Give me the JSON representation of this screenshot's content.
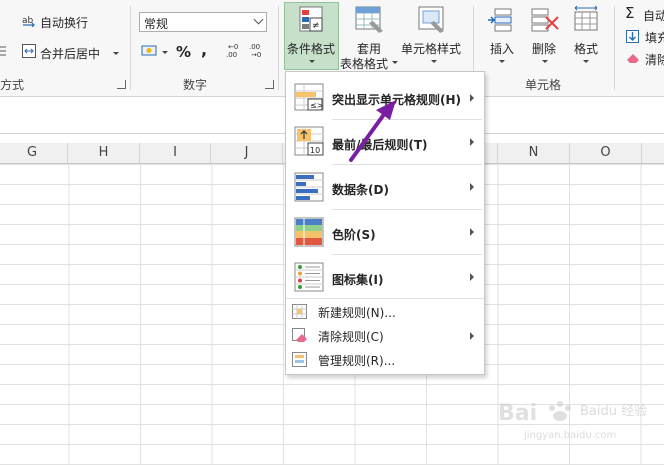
{
  "ribbon": {
    "wrap_text": "自动换行",
    "merge_center": "合并后居中",
    "align_group": "方式",
    "number_format": "常规",
    "number_group": "数字",
    "percent": "%",
    "comma": ",",
    "cond_format": "条件格式",
    "table_format_1": "套用",
    "table_format_2": "表格格式",
    "cell_styles": "单元格样式",
    "insert": "插入",
    "delete": "删除",
    "format": "格式",
    "cells_group": "单元格",
    "autosum": "自动",
    "fill": "填充",
    "clear": "清除"
  },
  "columns": [
    "G",
    "H",
    "I",
    "J",
    "N",
    "O"
  ],
  "menu": {
    "items": [
      {
        "label": "突出显示单元格规则(H)"
      },
      {
        "label": "最前/最后规则(T)"
      },
      {
        "label": "数据条(D)"
      },
      {
        "label": "色阶(S)"
      },
      {
        "label": "图标集(I)"
      },
      {
        "label": "新建规则(N)..."
      },
      {
        "label": "清除规则(C)"
      },
      {
        "label": "管理规则(R)..."
      }
    ]
  },
  "colors": {
    "highlight": "#c6e0c9",
    "arrow": "#7b1fa2"
  },
  "watermark": {
    "brand": "Baidu 经验",
    "url": "jingyan.baidu.com"
  }
}
